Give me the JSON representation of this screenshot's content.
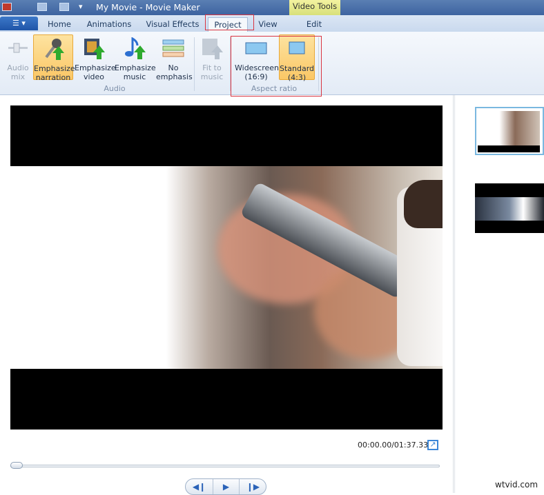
{
  "window": {
    "title": "My Movie - Movie Maker",
    "contextual_tab": "Video Tools"
  },
  "tabs": [
    {
      "label": "Home"
    },
    {
      "label": "Animations"
    },
    {
      "label": "Visual Effects"
    },
    {
      "label": "Project"
    },
    {
      "label": "View"
    },
    {
      "label": "Edit"
    }
  ],
  "ribbon": {
    "buttons": [
      {
        "line1": "Audio",
        "line2": "mix",
        "icon": "audio-mix-icon",
        "state": "disabled"
      },
      {
        "line1": "Emphasize",
        "line2": "narration",
        "icon": "microphone-icon",
        "state": "selected"
      },
      {
        "line1": "Emphasize",
        "line2": "video",
        "icon": "film-icon",
        "state": "normal"
      },
      {
        "line1": "Emphasize",
        "line2": "music",
        "icon": "music-note-icon",
        "state": "normal"
      },
      {
        "line1": "No",
        "line2": "emphasis",
        "icon": "bars-icon",
        "state": "normal"
      },
      {
        "line1": "Fit to",
        "line2": "music",
        "icon": "fit-music-icon",
        "state": "disabled"
      },
      {
        "line1": "Widescreen",
        "line2": "(16:9)",
        "icon": "widescreen-icon",
        "state": "normal"
      },
      {
        "line1": "Standard",
        "line2": "(4:3)",
        "icon": "standard-icon",
        "state": "selected"
      }
    ],
    "groups": {
      "audio": "Audio",
      "aspect": "Aspect ratio"
    }
  },
  "player": {
    "time": "00:00.00/01:37.33",
    "position_fraction": 0
  },
  "watermark": "wtvid.com",
  "colors": {
    "highlight": "#fbc766",
    "annotation": "#d9333f",
    "accent": "#3a86d8"
  }
}
